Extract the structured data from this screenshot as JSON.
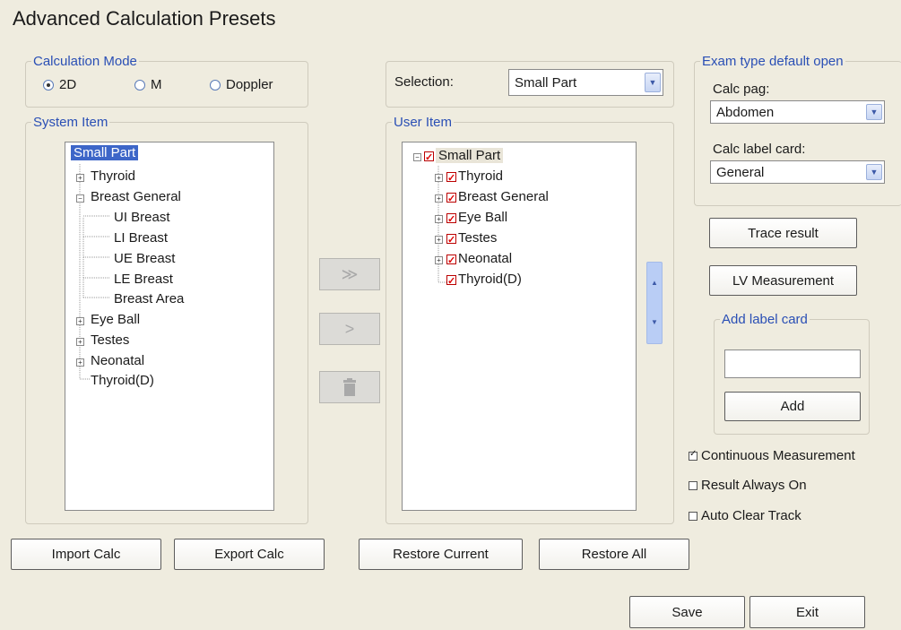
{
  "title": "Advanced Calculation Presets",
  "calc_mode": {
    "legend": "Calculation Mode",
    "options": [
      {
        "label": "2D",
        "selected": true
      },
      {
        "label": "M",
        "selected": false
      },
      {
        "label": "Doppler",
        "selected": false
      }
    ]
  },
  "system_item": {
    "legend": "System Item",
    "nodes": [
      "Small Part",
      "Thyroid",
      "Breast General",
      "UI Breast",
      "LI Breast",
      "UE Breast",
      "LE Breast",
      "Breast Area",
      "Eye Ball",
      "Testes",
      "Neonatal",
      "Thyroid(D)"
    ]
  },
  "selection": {
    "label": "Selection:",
    "value": "Small Part"
  },
  "user_item": {
    "legend": "User Item",
    "nodes": [
      "Small Part",
      "Thyroid",
      "Breast General",
      "Eye Ball",
      "Testes",
      "Neonatal",
      "Thyroid(D)"
    ]
  },
  "transfer": {
    "add_all": "≫",
    "add_one": ">",
    "delete_icon": "trash-icon"
  },
  "exam_default": {
    "legend": "Exam type default open",
    "calc_page_label": "Calc pag:",
    "calc_page_value": "Abdomen",
    "calc_label_card_label": "Calc label card:",
    "calc_label_card_value": "General"
  },
  "buttons": {
    "trace_result": "Trace result",
    "lv_measurement": "LV Measurement",
    "add": "Add",
    "import_calc": "Import Calc",
    "export_calc": "Export Calc",
    "restore_current": "Restore Current",
    "restore_all": "Restore All",
    "save": "Save",
    "exit": "Exit"
  },
  "add_label_card": {
    "legend": "Add label card",
    "input_value": ""
  },
  "options": {
    "continuous_measurement": {
      "label": "Continuous Measurement",
      "checked": true
    },
    "result_always_on": {
      "label": "Result Always On",
      "checked": false
    },
    "auto_clear_track": {
      "label": "Auto Clear Track",
      "checked": false
    }
  }
}
